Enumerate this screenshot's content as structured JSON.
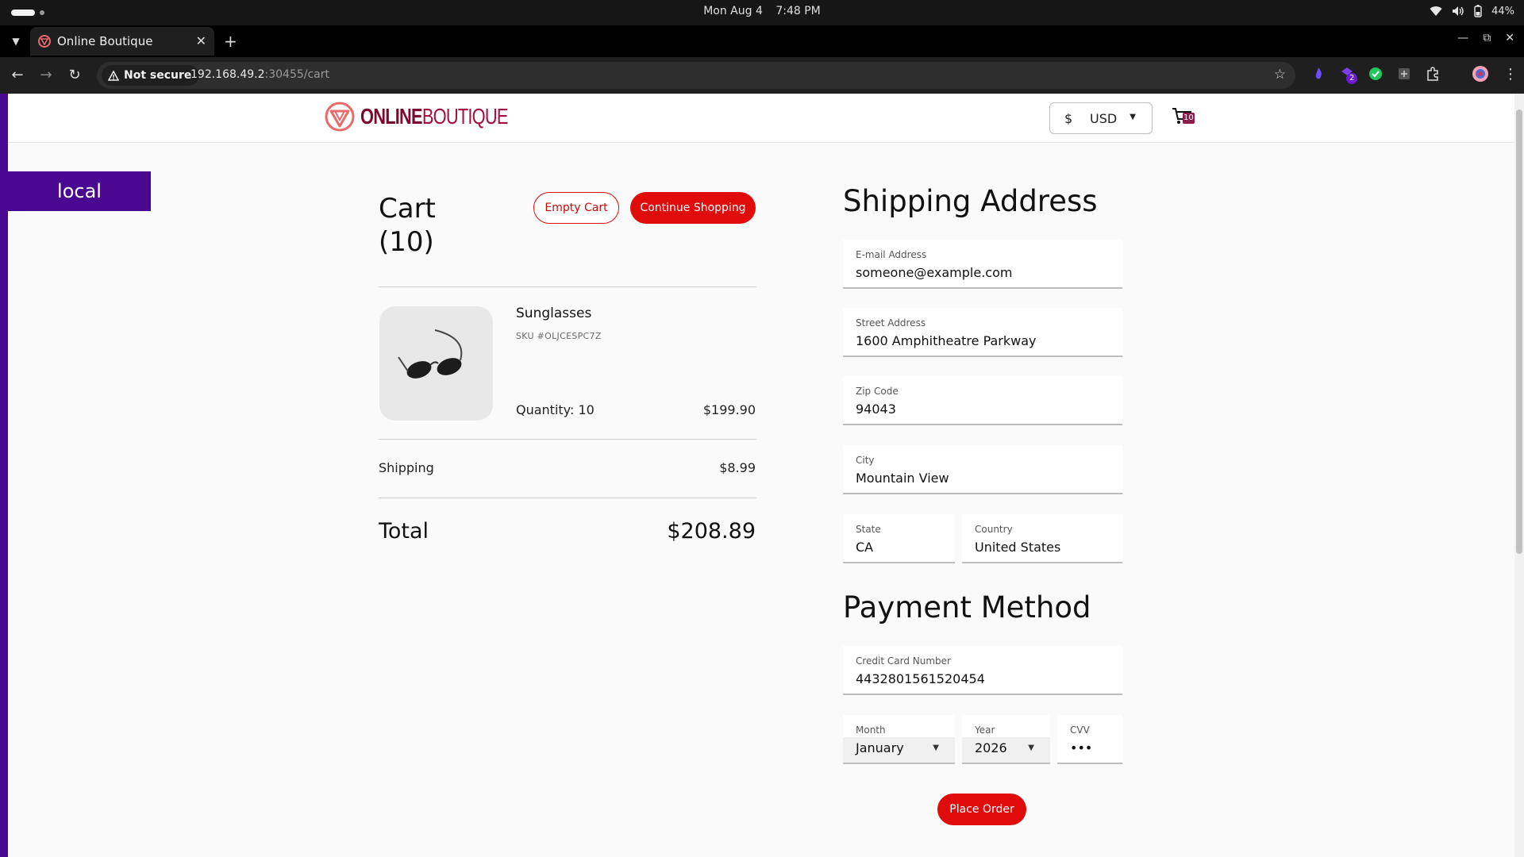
{
  "os": {
    "date": "Mon Aug 4",
    "time": "7:48 PM",
    "battery": "44%"
  },
  "browser": {
    "tab_title": "Online Boutique",
    "security_label": "Not secure",
    "url_host": "192.168.49.2",
    "url_rest": ":30455/cart",
    "extension_badge": "2"
  },
  "header": {
    "logo_bold": "ONLINE",
    "logo_light": "BOUTIQUE",
    "currency_symbol": "$",
    "currency_code": "USD",
    "cart_count": "10"
  },
  "env_banner": "local",
  "cart": {
    "title_line1": "Cart",
    "title_line2": "(10)",
    "empty_cart_label": "Empty Cart",
    "continue_shopping_label": "Continue Shopping",
    "items": [
      {
        "name": "Sunglasses",
        "sku": "SKU #OLJCESPC7Z",
        "quantity": "Quantity: 10",
        "price": "$199.90"
      }
    ],
    "shipping_label": "Shipping",
    "shipping_value": "$8.99",
    "total_label": "Total",
    "total_value": "$208.89"
  },
  "shipping_address": {
    "title": "Shipping Address",
    "email": {
      "label": "E-mail Address",
      "value": "someone@example.com"
    },
    "street": {
      "label": "Street Address",
      "value": "1600 Amphitheatre Parkway"
    },
    "zip": {
      "label": "Zip Code",
      "value": "94043"
    },
    "city": {
      "label": "City",
      "value": "Mountain View"
    },
    "state": {
      "label": "State",
      "value": "CA"
    },
    "country": {
      "label": "Country",
      "value": "United States"
    }
  },
  "payment": {
    "title": "Payment Method",
    "card_number": {
      "label": "Credit Card Number",
      "value": "4432801561520454"
    },
    "month": {
      "label": "Month",
      "value": "January"
    },
    "year": {
      "label": "Year",
      "value": "2026"
    },
    "cvv": {
      "label": "CVV",
      "value": "•••"
    },
    "place_order_label": "Place Order"
  },
  "colors": {
    "brand_red": "#e00b0b",
    "banner_purple": "#4a0891",
    "logo_maroon": "#a30f3b"
  }
}
